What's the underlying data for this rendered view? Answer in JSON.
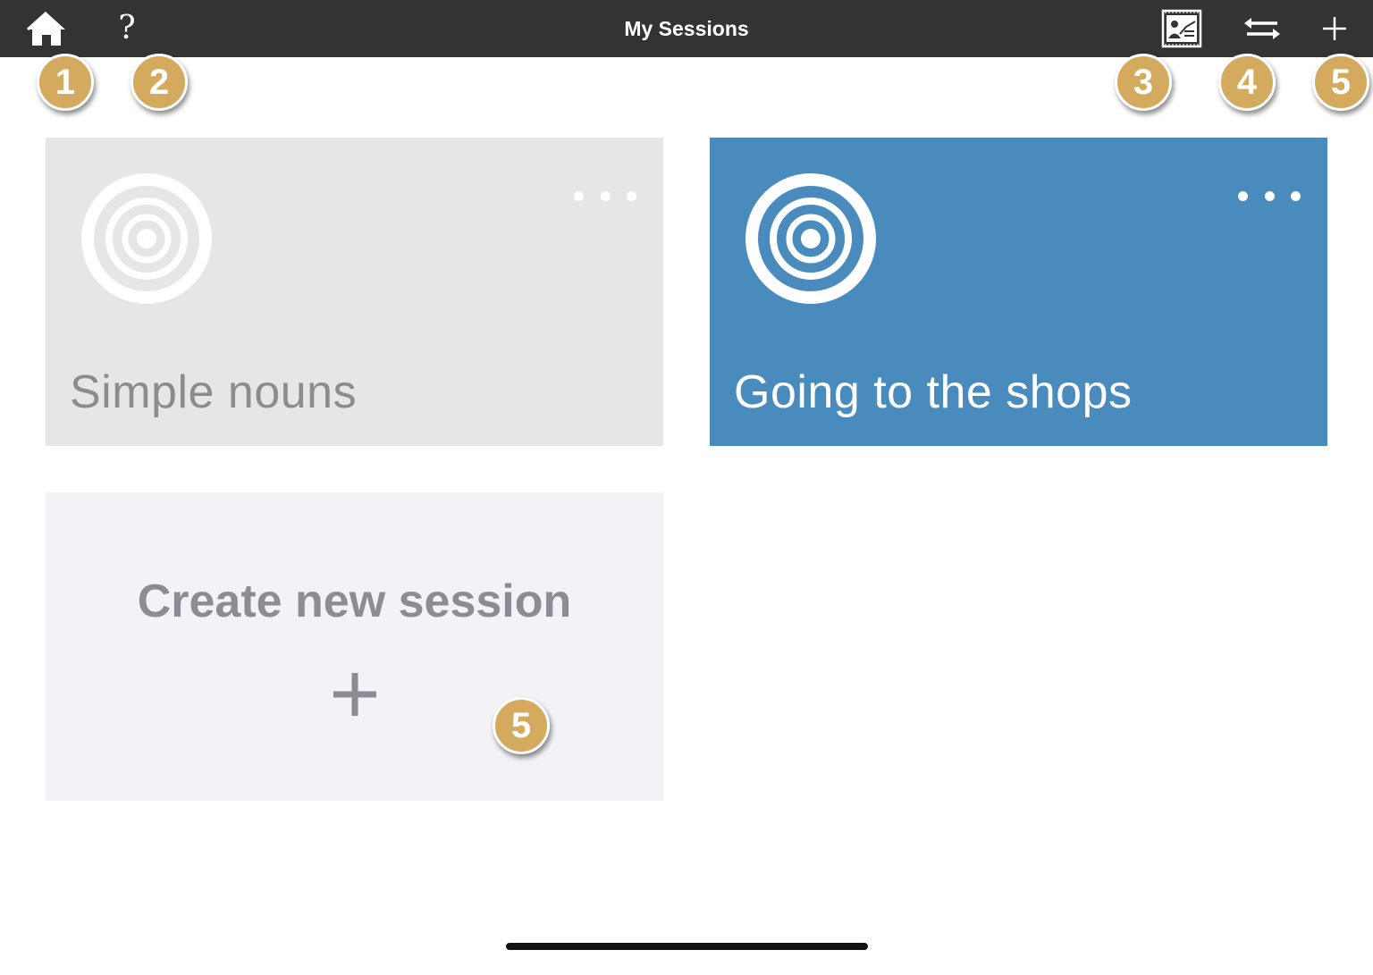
{
  "header": {
    "title": "My Sessions",
    "help_label": "?",
    "icons": {
      "home": "home-icon",
      "help": "help-icon",
      "view": "presentation-icon",
      "reorder": "reorder-arrows-icon",
      "add": "plus-icon"
    }
  },
  "badges": [
    "1",
    "2",
    "3",
    "4",
    "5",
    "5"
  ],
  "sessions": [
    {
      "label": "Simple nouns",
      "color": "#e6e6e6"
    },
    {
      "label": "Going to the shops",
      "color": "#4a8bbd"
    }
  ],
  "create": {
    "label": "Create new session"
  },
  "colors": {
    "topbar": "#333333",
    "badge": "#d4aa5e",
    "accent_blue": "#4a8bbd"
  }
}
